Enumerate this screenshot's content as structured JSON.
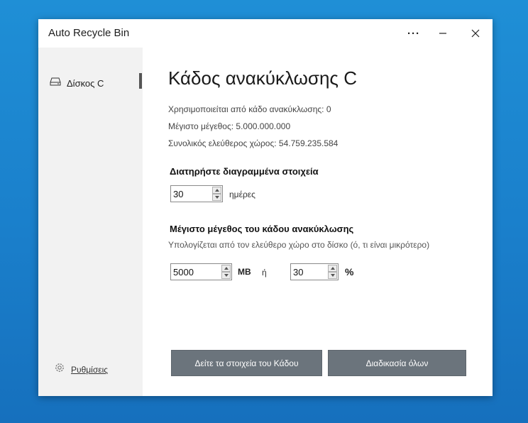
{
  "window": {
    "title": "Auto Recycle Bin",
    "controls": [
      "more-icon",
      "minimize-icon",
      "close-icon"
    ]
  },
  "sidebar": {
    "items": [
      {
        "label": "Δίσκος C",
        "icon": "drive-icon",
        "selected": true
      }
    ],
    "settings_label": "Ρυθμίσεις",
    "settings_icon": "gear-icon"
  },
  "main": {
    "heading": "Κάδος ανακύκλωσης C",
    "used_line": "Χρησιμοποιείται από κάδο ανακύκλωσης: 0",
    "max_size_line": "Μέγιστο μέγεθος: 5.000.000.000",
    "free_space_line": "Συνολικός ελεύθερος χώρος: 54.759.235.584",
    "keep_section": {
      "title": "Διατηρήστε διαγραμμένα στοιχεία",
      "days_value": "30",
      "days_unit": "ημέρες"
    },
    "max_size_section": {
      "title": "Μέγιστο μέγεθος του κάδου ανακύκλωσης",
      "subtitle": "Υπολογίζεται από τον ελεύθερο χώρο στο δίσκο (ό, τι είναι μικρότερο)",
      "mb_value": "5000",
      "mb_unit": "MB",
      "or_label": "ή",
      "percent_value": "30",
      "percent_unit": "%"
    },
    "buttons": {
      "view_items": "Δείτε τα στοιχεία του Κάδου",
      "process_all": "Διαδικασία όλων"
    }
  },
  "colors": {
    "desktop": "#1a7fcb",
    "button": "#6b747c",
    "sidebar": "#f2f2f2"
  }
}
